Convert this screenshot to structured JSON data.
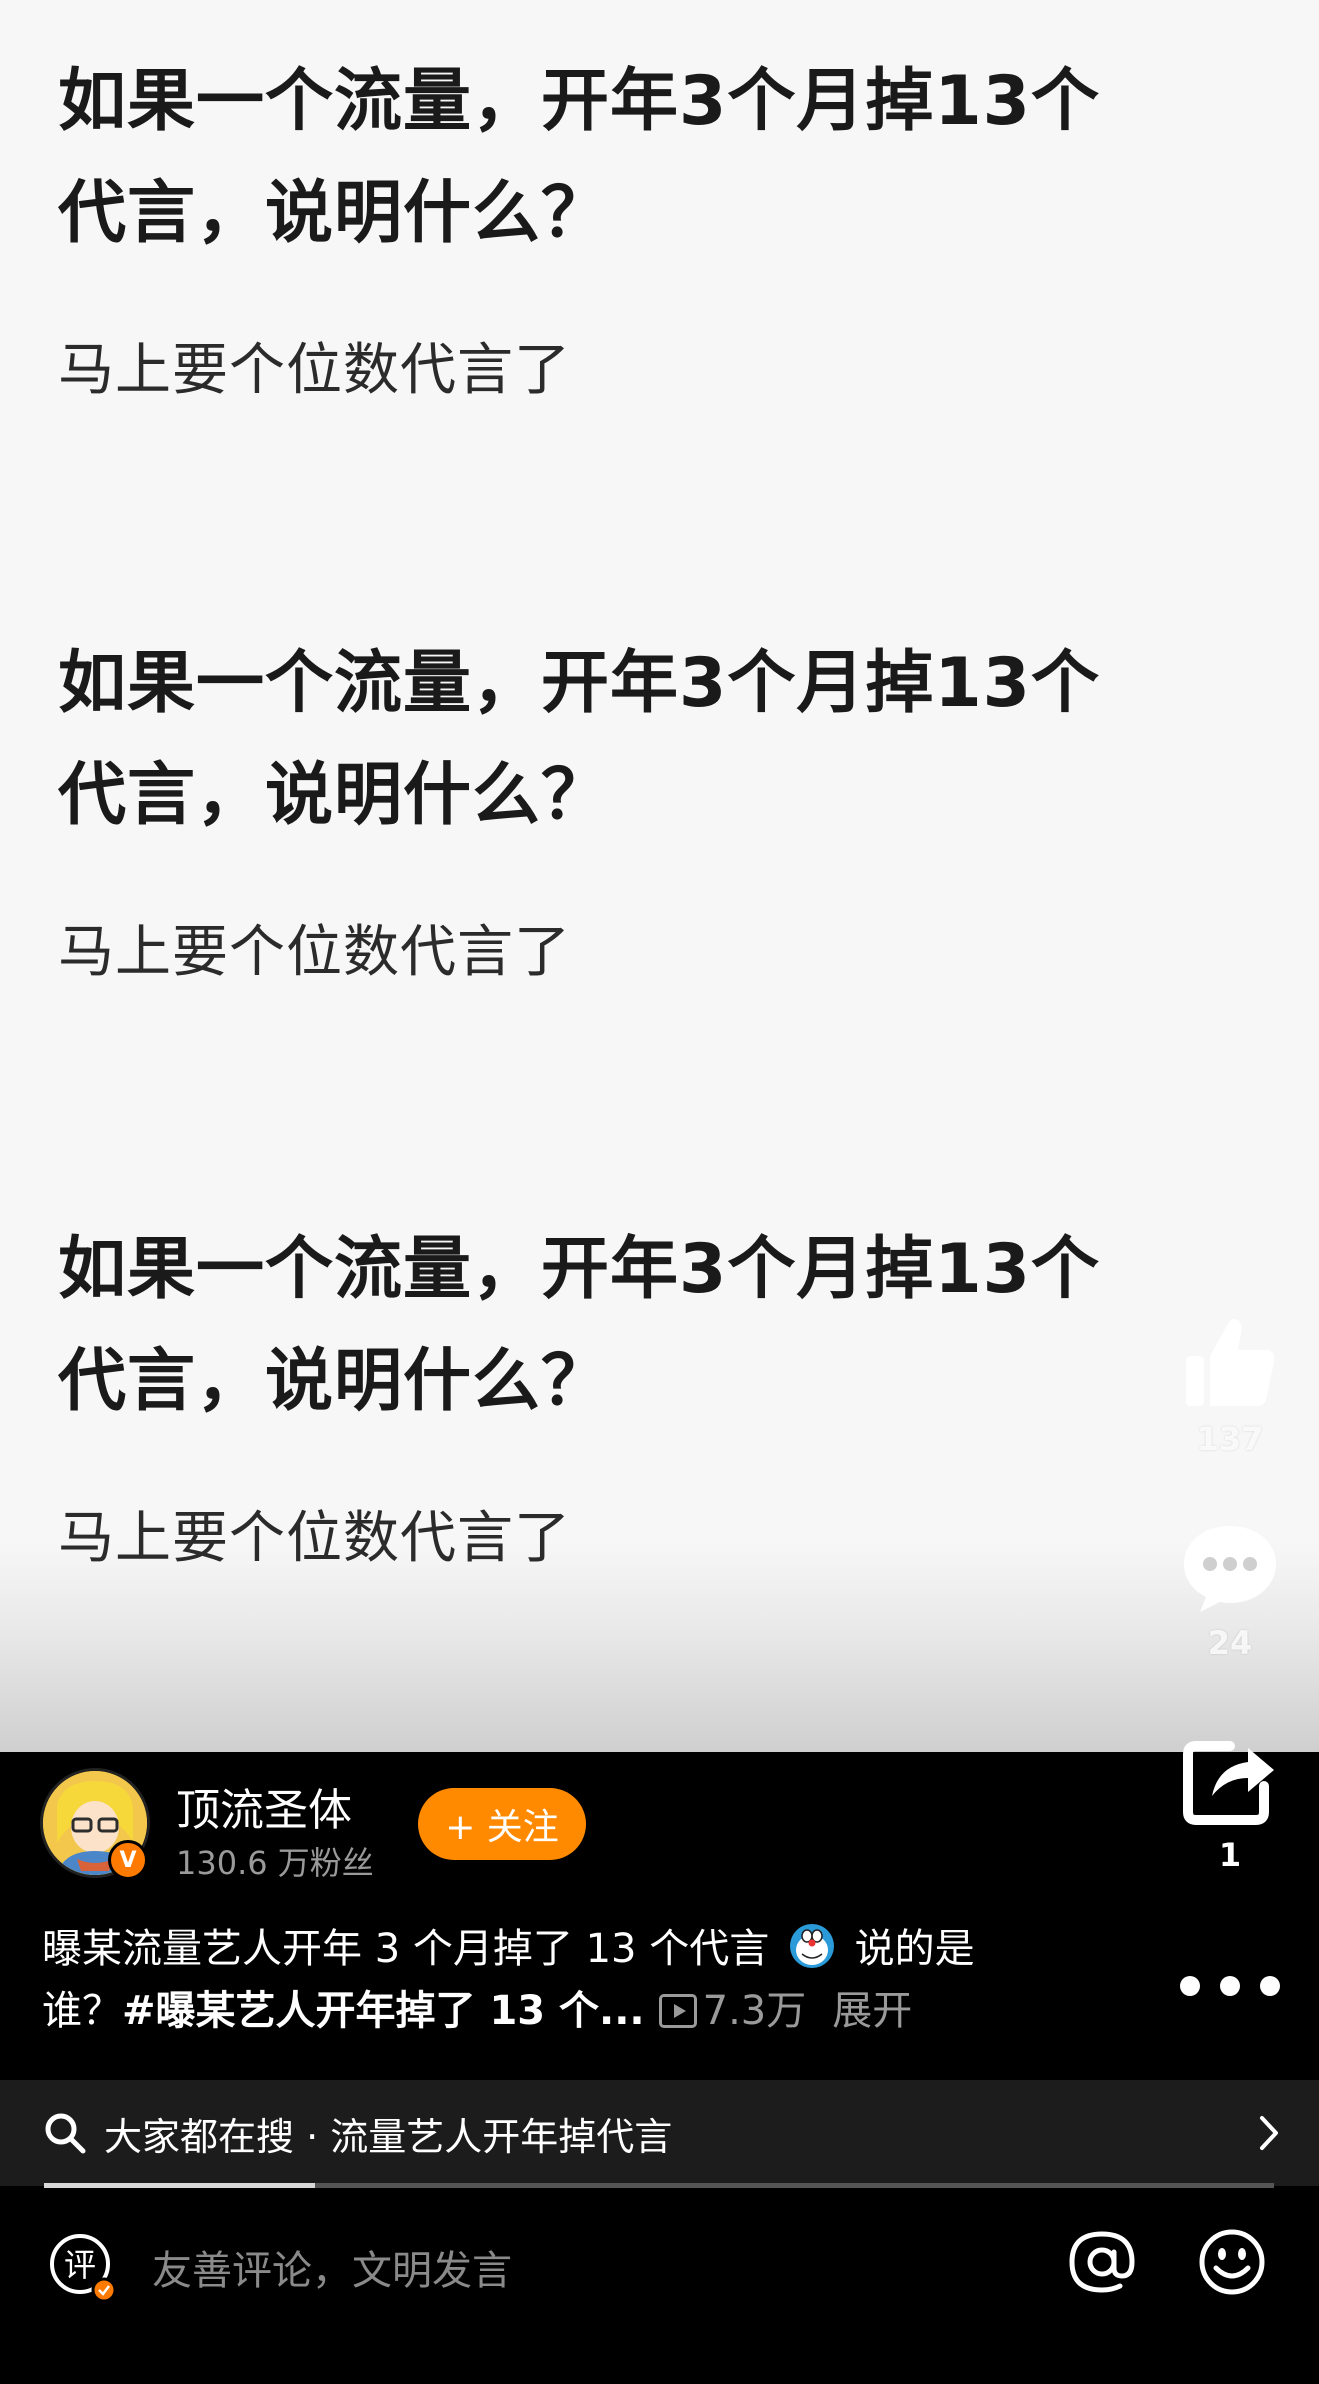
{
  "post": {
    "blocks": [
      {
        "question_line1": "如果一个流量，开年3个月掉13个",
        "question_line2": "代言，说明什么？",
        "answer": "马上要个位数代言了"
      },
      {
        "question_line1": "如果一个流量，开年3个月掉13个",
        "question_line2": "代言，说明什么？",
        "answer": "马上要个位数代言了"
      },
      {
        "question_line1": "如果一个流量，开年3个月掉13个",
        "question_line2": "代言，说明什么？",
        "answer": "马上要个位数代言了"
      }
    ]
  },
  "actions": {
    "like_count": "137",
    "comment_count": "24",
    "share_count": "1"
  },
  "author": {
    "name": "顶流圣体",
    "fans": "130.6 万粉丝",
    "verified_badge": "V",
    "follow_label": "+ 关注"
  },
  "caption": {
    "text_line1": "曝某流量艺人开年 3 个月掉了 13 个代言",
    "text_after_emoji": "说的是",
    "text_line2_start": "谁？",
    "hashtag": "#曝某艺人开年掉了 13 个...",
    "views": "7.3万",
    "expand": "展开"
  },
  "search_suggestion": {
    "text": "大家都在搜 · 流量艺人开年掉代言",
    "progress": 0.22
  },
  "comment_bar": {
    "comment_icon_glyph": "评",
    "placeholder": "友善评论，文明发言"
  },
  "icons": {
    "like": "thumbs-up-icon",
    "comment": "chat-bubble-icon",
    "share": "share-icon",
    "more": "more-dots-icon",
    "search": "search-icon",
    "chevron": "chevron-right-icon",
    "at": "at-icon",
    "emoji": "smiley-icon"
  },
  "colors": {
    "accent": "#ff8a00",
    "background": "#000000",
    "content_bg": "#f7f7f7"
  }
}
